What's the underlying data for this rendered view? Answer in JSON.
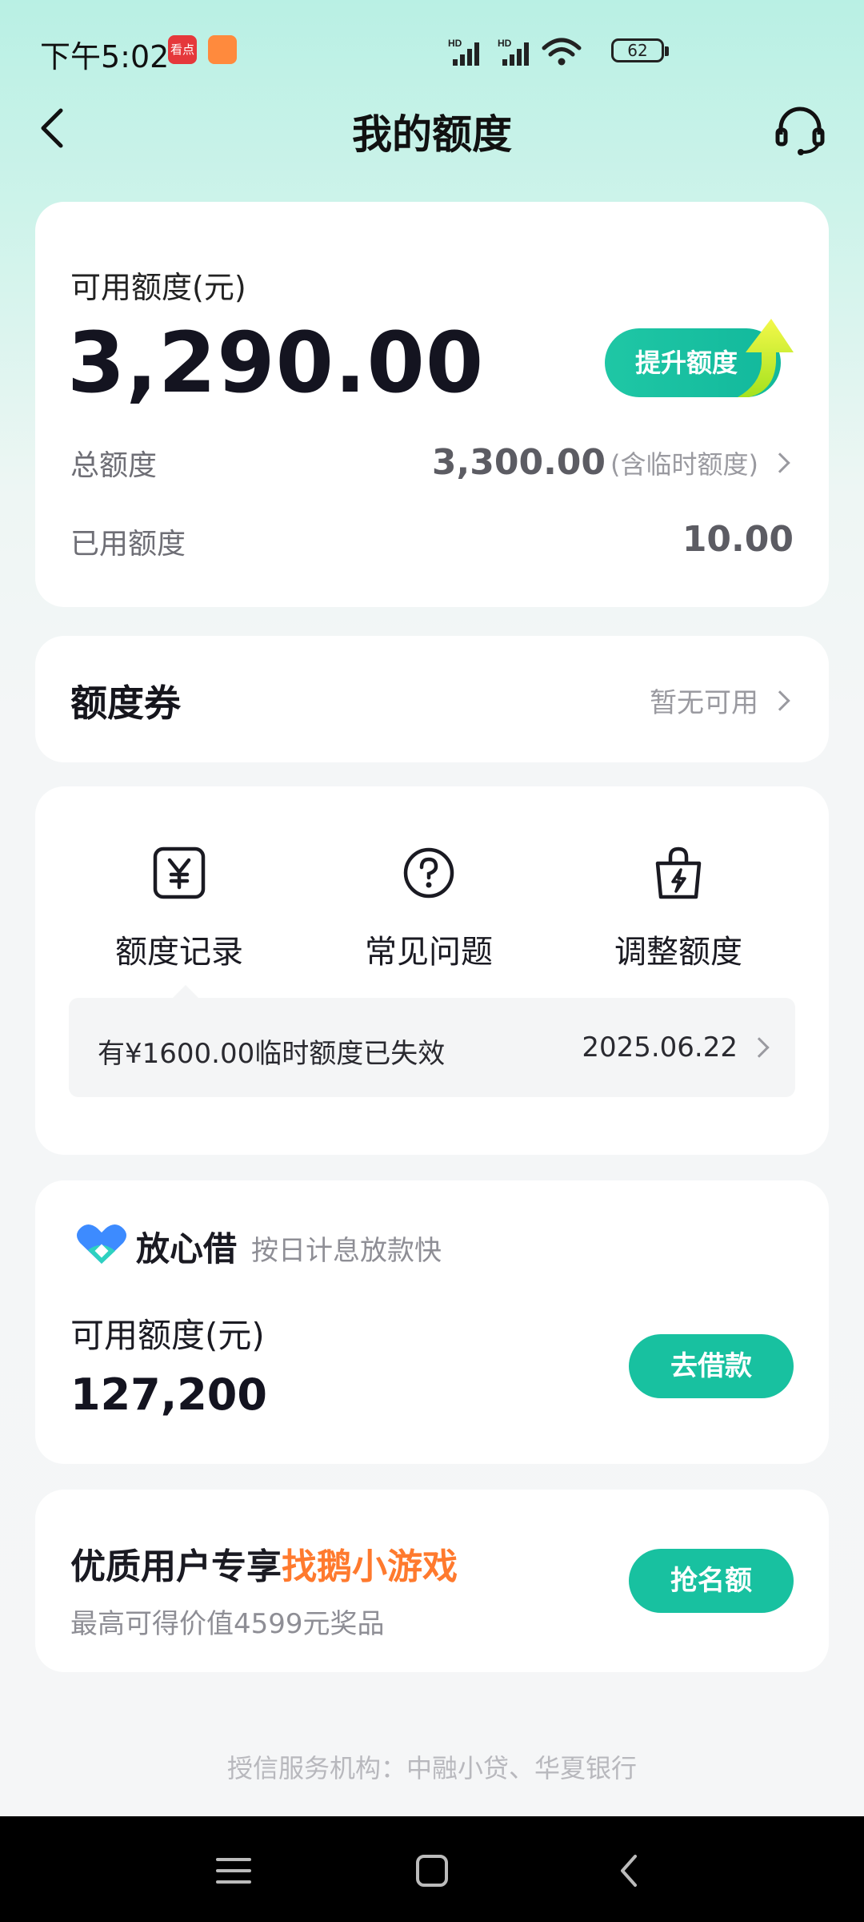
{
  "status_bar": {
    "time": "下午5:02",
    "notif_1": "看点",
    "battery": "62"
  },
  "nav": {
    "title": "我的额度"
  },
  "credit": {
    "available_label": "可用额度(元)",
    "available_amount": "3,290.00",
    "upgrade_label": "提升额度",
    "total_label": "总额度",
    "total_value": "3,300.00",
    "total_note": "(含临时额度)",
    "used_label": "已用额度",
    "used_value": "10.00"
  },
  "coupon": {
    "title": "额度券",
    "status": "暂无可用"
  },
  "actions": [
    {
      "label": "额度记录",
      "icon": "yen-record-icon"
    },
    {
      "label": "常见问题",
      "icon": "question-icon"
    },
    {
      "label": "调整额度",
      "icon": "bag-lightning-icon"
    }
  ],
  "notice": {
    "text": "有¥1600.00临时额度已失效",
    "date": "2025.06.22"
  },
  "loan": {
    "brand": "放心借",
    "slogan": "按日计息放款快",
    "available_label": "可用额度(元)",
    "amount": "127,200",
    "button": "去借款"
  },
  "promo": {
    "title_prefix": "优质用户专享",
    "title_highlight": "找鹅小游戏",
    "subtitle": "最高可得价值4599元奖品",
    "button": "抢名额"
  },
  "footer": {
    "text": "授信服务机构：中融小贷、华夏银行"
  },
  "colors": {
    "accent": "#18c1a0",
    "highlight": "#ff7a2e"
  }
}
